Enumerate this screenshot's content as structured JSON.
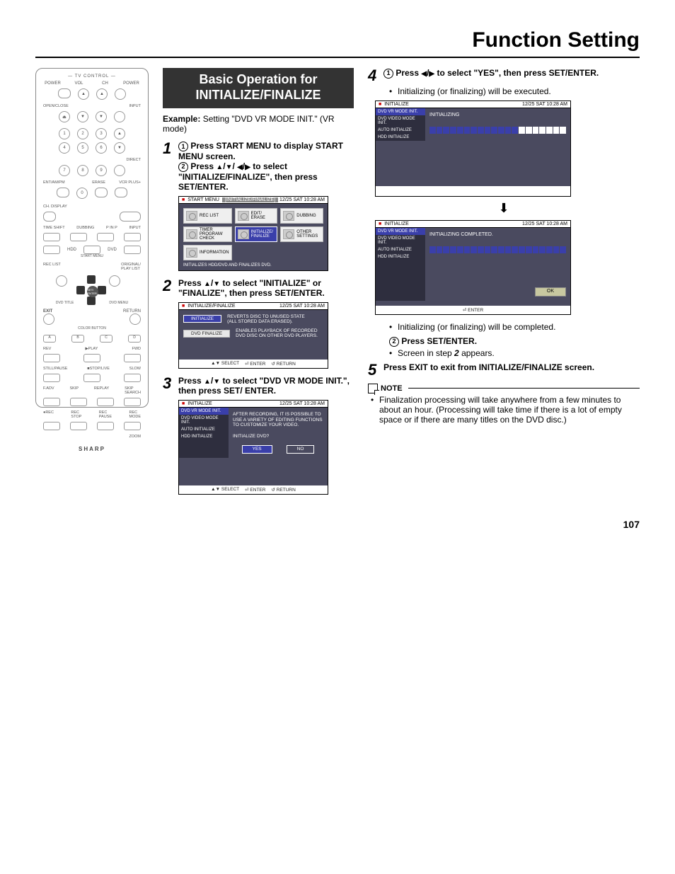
{
  "page": {
    "title": "Function Setting",
    "number": "107"
  },
  "remote": {
    "tv_control": "TV CONTROL",
    "labels": {
      "power": "POWER",
      "vol": "VOL",
      "ch": "CH",
      "input": "INPUT",
      "open_close": "OPEN/CLOSE",
      "direct": "DIRECT",
      "ent_ampm": "ENT/AM/PM",
      "erase": "ERASE",
      "vcr_plus": "VCR PLUS+",
      "ch_disp": "CH. DISPLAY",
      "vcr_off": "",
      "time_shift": "TIME SHIFT",
      "dubbing": "DUBBING",
      "pinp": "P IN P",
      "hdd": "HDD",
      "start_menu": "START MENU",
      "dvd": "DVD",
      "rec_list": "REC LIST",
      "orig_pl": "ORIGINAL/\nPLAY LIST",
      "dvd_title": "DVD TITLE",
      "dvd_menu": "DVD MENU",
      "set_enter": "SET/\nENTER",
      "exit": "EXIT",
      "return": "RETURN",
      "color_button": "COLOR BUTTON",
      "a": "A",
      "b": "B",
      "c": "C",
      "d": "D",
      "rev": "REV",
      "play": "PLAY",
      "fwd": "FWD",
      "still_pause": "STILL/PAUSE",
      "stop_live": "STOP/LIVE",
      "slow": "SLOW",
      "fadv": "F.ADV",
      "skip": "SKIP",
      "replay": "REPLAY",
      "search": "SKIP\nSEARCH",
      "rec": "REC",
      "rec_stop": "REC\nSTOP",
      "rec_pause": "REC\nPAUSE",
      "rec_mode": "REC\nMODE",
      "zoom": "ZOOM",
      "brand": "SHARP"
    }
  },
  "section": {
    "heading": "Basic Operation for INITIALIZE/FINALIZE"
  },
  "example": {
    "prefix": "Example:",
    "text": " Setting \"DVD VR MODE INIT.\" (VR mode)"
  },
  "steps": {
    "s1": {
      "num": "1",
      "l1a": " Press ",
      "l1b": "START MENU",
      "l1c": " to display START MENU screen.",
      "l2a": " Press ",
      "l2b": " to select \"INITIALIZE/FINALIZE\", then press ",
      "l2c": "SET/ENTER",
      "l2d": "."
    },
    "s2": {
      "num": "2",
      "a": "Press ",
      "b": " to select \"INITIALIZE\" or \"FINALIZE\", then press ",
      "c": "SET/ENTER",
      "d": "."
    },
    "s3": {
      "num": "3",
      "a": "Press ",
      "b": " to select \"DVD VR MODE INIT.\", then press ",
      "c": "SET/ ENTER",
      "d": "."
    },
    "s4": {
      "num": "4",
      "a": " Press ",
      "b": " to select \"YES\", then press ",
      "c": "SET/ENTER",
      "d": ".",
      "bullet": "Initializing (or finalizing) will be executed."
    },
    "s4b": {
      "bullet": "Initializing (or finalizing) will be completed.",
      "press": " Press ",
      "se": "SET/ENTER",
      "dot": ".",
      "screen_a": "Screen in step ",
      "screen_n": "2",
      "screen_b": " appears."
    },
    "s5": {
      "num": "5",
      "a": "Press ",
      "b": "EXIT",
      "c": " to exit from INITIALIZE/FINALIZE screen."
    }
  },
  "osd_timestamp": "12/25 SAT 10:28 AM",
  "osd1": {
    "title_tab": "START MENU",
    "title_sub": "[INITIALIZE/FINALIZE]",
    "cells": [
      "REC LIST",
      "EDIT/\nERASE",
      "DUBBING",
      "TIMER\nPROGRAM/\nCHECK",
      "INITIALIZE/\nFINALIZE",
      "OTHER\nSETTINGS",
      "INFORMATION"
    ],
    "footer": "INITIALIZES HDD/DVD AND FINALIZES DVD."
  },
  "osd2": {
    "title_tab": "INITIALIZE/FINALIZE",
    "rows": [
      {
        "btn": "INITIALIZE",
        "desc": "REVERTS DISC TO UNUSED STATE\n(ALL STORED DATA ERASED)."
      },
      {
        "btn": "DVD FINALIZE",
        "desc": "ENABLES PLAYBACK OF RECORDED\nDVD DISC ON OTHER DVD PLAYERS."
      }
    ],
    "footer": {
      "select": "SELECT",
      "enter": "ENTER",
      "return": "RETURN"
    }
  },
  "osd3": {
    "title_tab": "INITIALIZE",
    "side": [
      "DVD VR MODE INIT.",
      "DVD VIDEO MODE INIT.",
      "AUTO INITIALIZE",
      "HDD INITIALIZE"
    ],
    "msg": "AFTER RECORDING, IT IS POSSIBLE TO\nUSE A VARIETY OF EDITING FUNCTIONS\nTO CUSTOMIZE YOUR VIDEO.",
    "prompt": "INITIALIZE DVD?",
    "yes": "YES",
    "no": "NO",
    "footer": {
      "select": "SELECT",
      "enter": "ENTER",
      "return": "RETURN"
    }
  },
  "osd4a": {
    "title_tab": "INITIALIZE",
    "side": [
      "DVD VR MODE INIT.",
      "DVD VIDEO MODE INIT.",
      "AUTO INITIALIZE",
      "HDD INITIALIZE"
    ],
    "status": "INITIALIZING",
    "progress_filled": 13,
    "progress_total": 20
  },
  "osd4b": {
    "title_tab": "INITIALIZE",
    "side": [
      "DVD VR MODE INIT.",
      "DVD VIDEO MODE INIT.",
      "AUTO INITIALIZE",
      "HDD INITIALIZE"
    ],
    "status": "INITIALIZING COMPLETED.",
    "ok": "OK",
    "enter": "ENTER"
  },
  "note": {
    "label": "NOTE",
    "text": "Finalization processing will take anywhere from a few minutes to about an hour. (Processing will take time if there is a lot of empty space or if there are many titles on the DVD disc.)"
  }
}
